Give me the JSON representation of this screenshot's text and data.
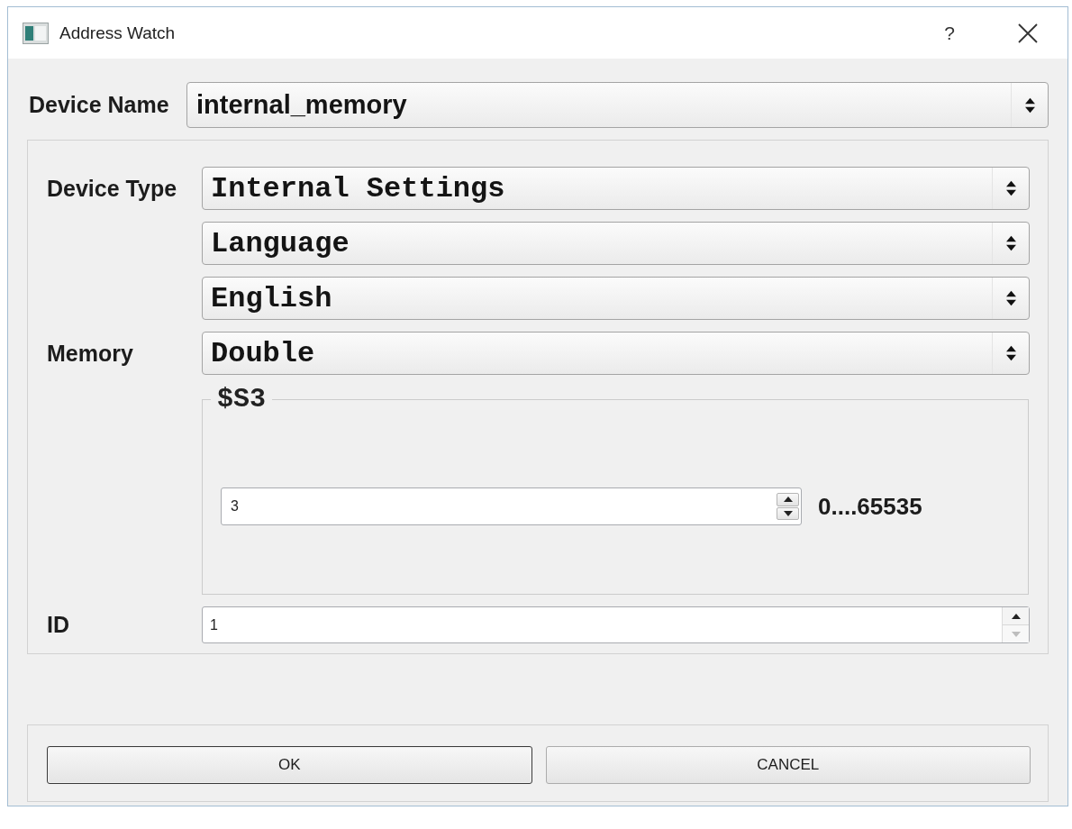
{
  "window": {
    "title": "Address Watch",
    "help": "?"
  },
  "device_name": {
    "label": "Device Name",
    "value": "internal_memory"
  },
  "settings": {
    "rows": [
      {
        "label": "Device Type",
        "value": "Internal Settings"
      },
      {
        "value": "Language"
      },
      {
        "value": "English"
      },
      {
        "label": "Memory",
        "value": "Double"
      }
    ],
    "group": {
      "title": "$S3",
      "spinbox": {
        "value": "3",
        "step_down_disabled": false
      },
      "range": "0....65535"
    },
    "id": {
      "label": "ID",
      "spinbox": {
        "value": "1",
        "step_down_disabled": true
      }
    }
  },
  "buttons": [
    {
      "label": "OK",
      "default": true
    },
    {
      "label": "CANCEL",
      "default": false
    }
  ]
}
